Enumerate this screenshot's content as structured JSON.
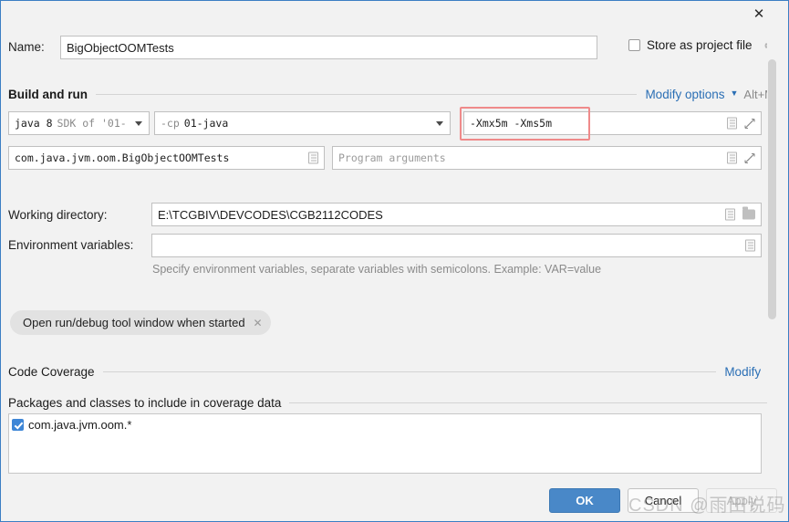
{
  "dialog": {
    "close_icon": "close-icon"
  },
  "name_row": {
    "label": "Name:",
    "value": "BigObjectOOMTests",
    "store_as_project_file": {
      "label": "Store as project file",
      "checked": false,
      "gear_icon": "gear-icon"
    }
  },
  "build_and_run": {
    "title": "Build and run",
    "modify_options_label": "Modify options",
    "modify_options_chevron": "chevron-down-icon",
    "shortcut": "Alt+M",
    "sdk_combo": {
      "prefix": "java 8",
      "suffix": "SDK of '01-"
    },
    "classpath_combo": {
      "prefix": "-cp",
      "suffix": "01-java"
    },
    "vm_options": {
      "value": "-Xmx5m  -Xms5m",
      "highlight_color": "#ef8a8a",
      "macro_icon": "macro-icon",
      "expand_icon": "expand-icon"
    },
    "main_class": {
      "value": "com.java.jvm.oom.BigObjectOOMTests",
      "macro_icon": "macro-icon"
    },
    "program_arguments": {
      "placeholder": "Program arguments",
      "macro_icon": "macro-icon",
      "expand_icon": "expand-icon"
    }
  },
  "working_directory": {
    "label": "Working directory:",
    "value": "E:\\TCGBIV\\DEVCODES\\CGB2112CODES",
    "macro_icon": "macro-icon",
    "browse_icon": "folder-icon"
  },
  "environment_variables": {
    "label": "Environment variables:",
    "value": "",
    "macro_icon": "macro-icon",
    "hint": "Specify environment variables, separate variables with semicolons. Example: VAR=value"
  },
  "chip": {
    "label": "Open run/debug tool window when started",
    "remove_icon": "close-icon"
  },
  "code_coverage": {
    "title": "Code Coverage",
    "modify_label": "Modify",
    "modify_chevron": "chevron-down-icon",
    "packages_title": "Packages and classes to include in coverage data",
    "items": [
      {
        "label": "com.java.jvm.oom.*",
        "checked": true
      }
    ]
  },
  "buttons": {
    "ok": "OK",
    "cancel": "Cancel",
    "apply": "Apply"
  },
  "watermark": {
    "text": "CSDN @雨田说码"
  },
  "colors": {
    "accent": "#4988c8",
    "link": "#2b6fb5",
    "highlight": "#ef8a8a"
  }
}
